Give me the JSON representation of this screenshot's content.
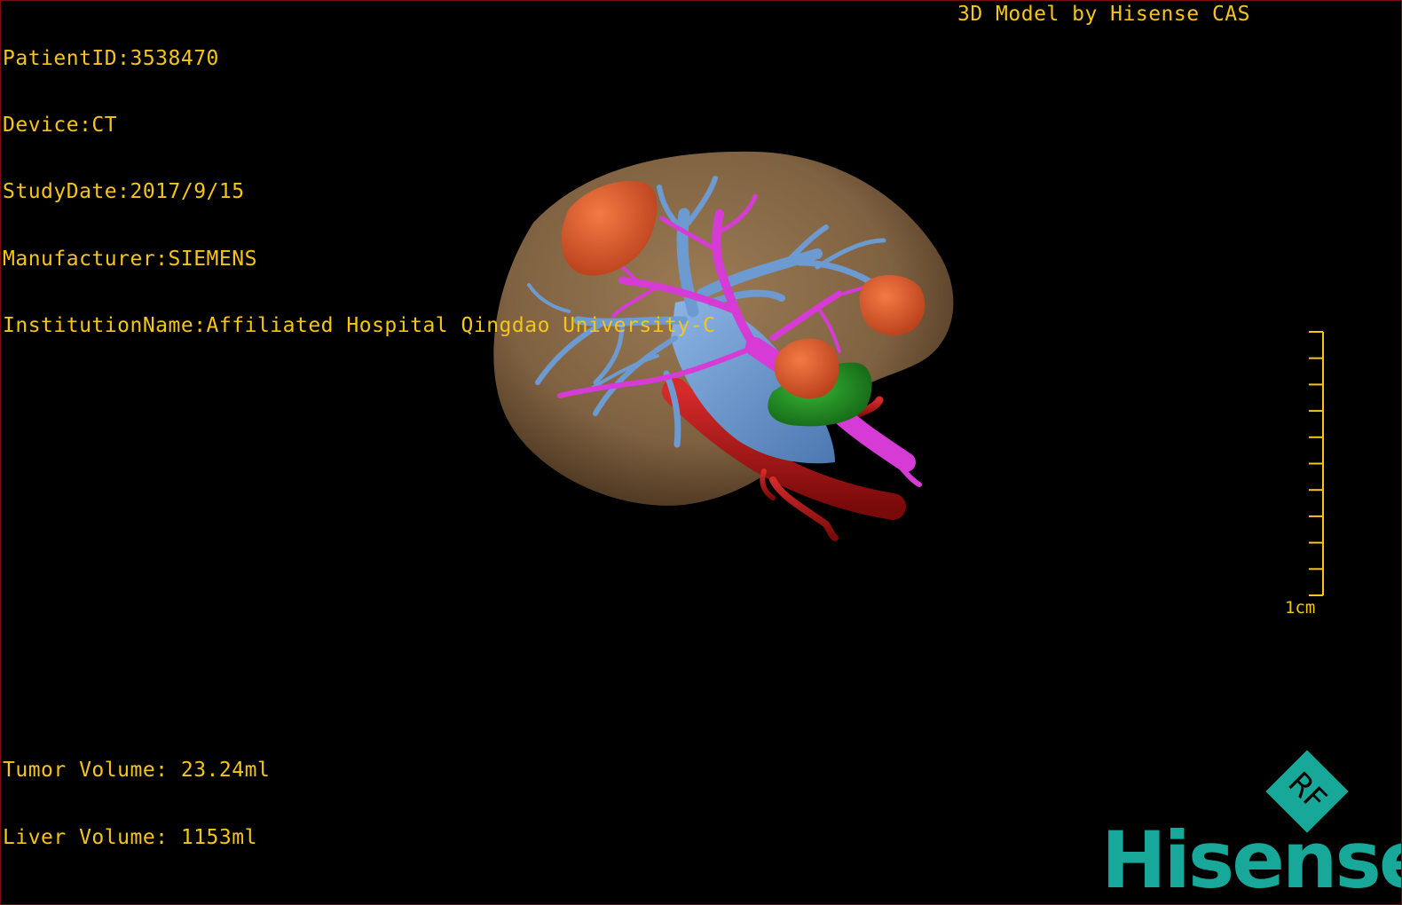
{
  "study_info": {
    "patient_id": "PatientID:3538470",
    "device": "Device:CT",
    "study_date": "StudyDate:2017/9/15",
    "manufacturer": "Manufacturer:SIEMENS",
    "institution": "InstitutionName:Affiliated Hospital Qingdao University-C"
  },
  "model_credit": "3D Model by Hisense CAS",
  "volumes": {
    "tumor": "Tumor Volume: 23.24ml",
    "liver": "Liver Volume: 1153ml"
  },
  "scale": {
    "label": "1cm",
    "tick_count": 10
  },
  "logo": {
    "brand_text": "Hisense",
    "badge_letters": "RF",
    "brand_color": "#17a89a"
  },
  "colors": {
    "overlay_text": "#f5c518",
    "liver": "#8a6a47",
    "hepatic_vein": "#6d9bd1",
    "portal_vein": "#d63bd6",
    "artery": "#b0161b",
    "tumor": "#e0572a",
    "gallbladder": "#1f8a1f"
  }
}
